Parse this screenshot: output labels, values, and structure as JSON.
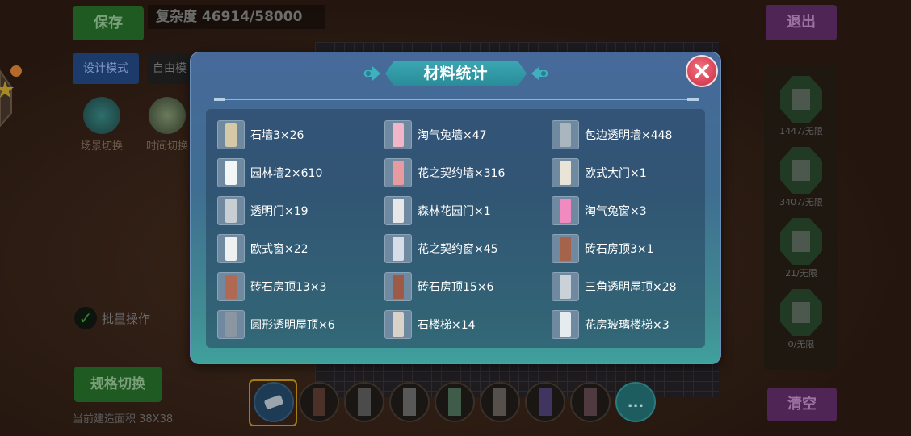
{
  "background": {
    "save_label": "保存",
    "complexity_text": "复杂度 46914/58000",
    "design_mode_label": "设计模式",
    "free_mode_label": "自由模",
    "scene_switch_label": "场景切换",
    "time_switch_label": "时间切换",
    "exit_label": "退出",
    "clear_label": "清空",
    "batch_label": "批量操作",
    "spec_switch_label": "规格切换",
    "area_text": "当前建造面积 38X38",
    "right_panel": [
      {
        "count": "1447/无限"
      },
      {
        "count": "3407/无限"
      },
      {
        "count": "21/无限"
      },
      {
        "count": "0/无限"
      }
    ],
    "toolbar_more": "..."
  },
  "modal": {
    "title": "材料统计",
    "items": [
      {
        "label": "石墙3×26",
        "icon": "stone-wall-icon",
        "color": "#d6c9a8"
      },
      {
        "label": "淘气兔墙×47",
        "icon": "bunny-wall-icon",
        "color": "#f1b6c8"
      },
      {
        "label": "包边透明墙×448",
        "icon": "edged-glass-wall-icon",
        "color": "#aab6bf"
      },
      {
        "label": "园林墙2×610",
        "icon": "garden-wall-icon",
        "color": "#f2f6f6"
      },
      {
        "label": "花之契约墙×316",
        "icon": "flower-wall-icon",
        "color": "#e79aa0"
      },
      {
        "label": "欧式大门×1",
        "icon": "european-gate-icon",
        "color": "#e9e4d8"
      },
      {
        "label": "透明门×19",
        "icon": "glass-door-icon",
        "color": "#c8cfd2"
      },
      {
        "label": "森林花园门×1",
        "icon": "forest-garden-door-icon",
        "color": "#e7e7e7"
      },
      {
        "label": "淘气兔窗×3",
        "icon": "bunny-window-icon",
        "color": "#f08ac0"
      },
      {
        "label": "欧式窗×22",
        "icon": "european-window-icon",
        "color": "#eef0f2"
      },
      {
        "label": "花之契约窗×45",
        "icon": "flower-window-icon",
        "color": "#d6dde8"
      },
      {
        "label": "砖石房顶3×1",
        "icon": "brick-roof-icon",
        "color": "#a5634c"
      },
      {
        "label": "砖石房顶13×3",
        "icon": "brick-roof-pyramid-icon",
        "color": "#b06a54"
      },
      {
        "label": "砖石房顶15×6",
        "icon": "brick-roof-flat-icon",
        "color": "#9c5a47"
      },
      {
        "label": "三角透明屋顶×28",
        "icon": "triangle-glass-roof-icon",
        "color": "#c9d2d8"
      },
      {
        "label": "圆形透明屋顶×6",
        "icon": "round-glass-roof-icon",
        "color": "#8a96a2"
      },
      {
        "label": "石楼梯×14",
        "icon": "stone-stairs-icon",
        "color": "#d8d2c8"
      },
      {
        "label": "花房玻璃楼梯×3",
        "icon": "greenhouse-glass-stairs-icon",
        "color": "#e5ecef"
      }
    ]
  }
}
